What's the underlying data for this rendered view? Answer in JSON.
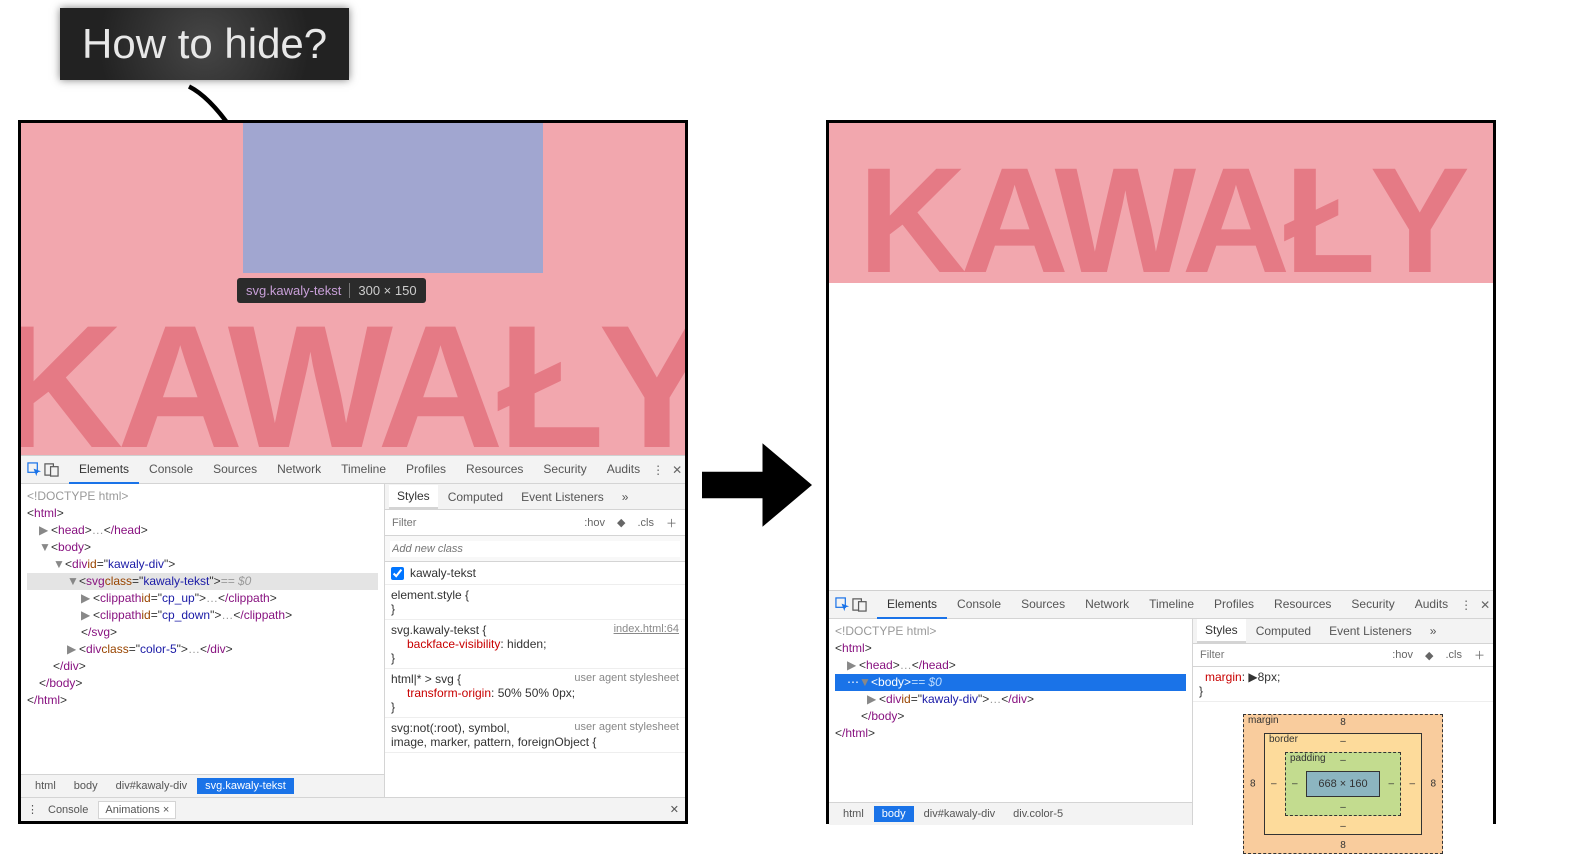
{
  "annotation": {
    "label": "How to hide?"
  },
  "render": {
    "banner_text": "KAWAŁY",
    "tooltip": {
      "selector": "svg.kawaly-tekst",
      "dimensions": "300 × 150"
    }
  },
  "devtools": {
    "tabs": [
      "Elements",
      "Console",
      "Sources",
      "Network",
      "Timeline",
      "Profiles",
      "Resources",
      "Security",
      "Audits"
    ],
    "active_tab": "Elements",
    "styles_tabs": [
      "Styles",
      "Computed",
      "Event Listeners"
    ],
    "filter_placeholder": "Filter",
    "hov_btn": ":hov",
    "cls_btn": ".cls",
    "add_class_placeholder": "Add new class",
    "class_check": "kawaly-tekst",
    "drawer_tabs": [
      "Console",
      "Animations ×"
    ]
  },
  "dom_left": {
    "doctype": "<!DOCTYPE html>",
    "html_open": "html",
    "head": {
      "open": "head",
      "ellipsis": "…",
      "close": "/head"
    },
    "body_open": "body",
    "div_kawaly": {
      "tag": "div",
      "attr": "id",
      "val": "kawaly-div"
    },
    "svg_line": {
      "tag": "svg",
      "attr": "class",
      "val": "kawaly-tekst",
      "eq": " == $0"
    },
    "cp_up": {
      "tag": "clippath",
      "attr": "id",
      "val": "cp_up",
      "close": "/clippath"
    },
    "cp_down": {
      "tag": "clippath",
      "attr": "id",
      "val": "cp_down",
      "close": "/clippath"
    },
    "svg_close": "/svg",
    "color5": {
      "tag": "div",
      "attr": "class",
      "val": " color-5",
      "close": "/div"
    },
    "div_close": "/div",
    "body_close": "/body",
    "html_close": "/html",
    "crumbs": [
      "html",
      "body",
      "div#kawaly-div",
      "svg.kawaly-tekst"
    ]
  },
  "dom_right": {
    "doctype": "<!DOCTYPE html>",
    "html_open": "html",
    "head": {
      "open": "head",
      "ellipsis": "…",
      "close": "/head"
    },
    "body_line": {
      "tag": "body",
      "eq": " == $0"
    },
    "div_kawaly": {
      "tag": "div",
      "attr": "id",
      "val": "kawaly-div",
      "ellipsis": "…",
      "close": "/div"
    },
    "body_close": "/body",
    "html_close": "/html",
    "crumbs": [
      "html",
      "body",
      "div#kawaly-div",
      "div.color-5"
    ]
  },
  "rules_left": {
    "r1": {
      "sel": "element.style {",
      "close": "}"
    },
    "r2": {
      "sel": "svg.kawaly-tekst {",
      "prop": "backface-visibility",
      "val": "hidden;",
      "close": "}",
      "src": "index.html:64"
    },
    "r3": {
      "sel": "html|* > svg {",
      "prop": "transform-origin",
      "val": "50% 50% 0px;",
      "close": "}",
      "ua": "user agent stylesheet"
    },
    "r4": {
      "sel": "svg:not(:root), symbol,",
      "line2": "image, marker, pattern, foreignObject {",
      "ua": "user agent stylesheet"
    }
  },
  "rules_right": {
    "r1": {
      "prop": "margin",
      "val": "8px;",
      "close": "}"
    }
  },
  "boxmodel": {
    "margin_label": "margin",
    "border_label": "border",
    "padding_label": "padding",
    "content": "668 × 160",
    "m_top": "8",
    "m_right": "8",
    "m_bottom": "8",
    "m_left": "8",
    "dash": "–"
  }
}
